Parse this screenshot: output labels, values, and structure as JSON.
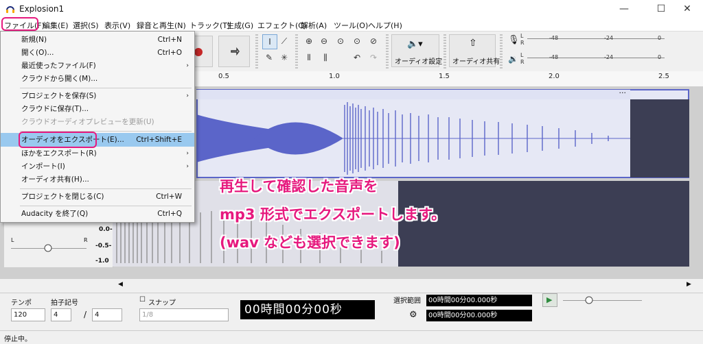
{
  "window": {
    "title": "Explosion1",
    "controls": {
      "minimize": "—",
      "maximize": "☐",
      "close": "✕"
    }
  },
  "menubar": {
    "items": [
      "ファイル(F)",
      "編集(E)",
      "選択(S)",
      "表示(V)",
      "録音と再生(N)",
      "トラック(T)",
      "生成(G)",
      "エフェクト(C)",
      "解析(A)",
      "ツール(O)",
      "ヘルプ(H)"
    ]
  },
  "toolbar": {
    "audio_setup_label": "オーディオ設定",
    "share_audio_label": "オーディオ共有",
    "meter_scale": [
      "-48",
      "-24",
      "0"
    ],
    "record_meter_lr": [
      "L",
      "R"
    ],
    "play_meter_lr": [
      "L",
      "R"
    ]
  },
  "ruler": {
    "ticks": [
      "0.5",
      "1.0",
      "1.5",
      "2.0",
      "2.5"
    ]
  },
  "track2": {
    "scale": [
      "0.0-",
      "-0.5-",
      "-1.0"
    ],
    "pan_labels": [
      "L",
      "R"
    ]
  },
  "file_menu": {
    "items": [
      {
        "label": "新規(N)",
        "shortcut": "Ctrl+N"
      },
      {
        "label": "開く(O)...",
        "shortcut": "Ctrl+O"
      },
      {
        "label": "最近使ったファイル(F)",
        "arrow": "›"
      },
      {
        "label": "クラウドから開く(M)..."
      },
      {
        "label": "プロジェクトを保存(S)",
        "arrow": "›"
      },
      {
        "label": "クラウドに保存(T)..."
      },
      {
        "label": "クラウドオーディオプレビューを更新(U)",
        "disabled": true
      },
      {
        "label": "オーディオをエクスポート(E)...",
        "shortcut": "Ctrl+Shift+E",
        "highlighted": true
      },
      {
        "label": "ほかをエクスポート(R)",
        "arrow": "›"
      },
      {
        "label": "インポート(I)",
        "arrow": "›"
      },
      {
        "label": "オーディオ共有(H)..."
      },
      {
        "label": "プロジェクトを閉じる(C)",
        "shortcut": "Ctrl+W"
      },
      {
        "label": "Audacity を終了(Q)",
        "shortcut": "Ctrl+Q"
      }
    ]
  },
  "annotation": {
    "line1": "再生して確認した音声を",
    "line2": "mp3 形式でエクスポートします。",
    "line3": "(wav なども選択できます)"
  },
  "bottom": {
    "tempo_label": "テンポ",
    "tempo_value": "120",
    "time_sig_label": "拍子記号",
    "time_sig_num": "4",
    "time_sig_sep": "/",
    "time_sig_den": "4",
    "snap_label": "スナップ",
    "snap_value": "1/8",
    "time_display": "00時間00分00秒",
    "selection_label": "選択範囲",
    "selection_start": "00時間00分00.000秒",
    "selection_end": "00時間00分00.000秒"
  },
  "status": {
    "text": "停止中。"
  },
  "colors": {
    "accent_pink": "#e6197e",
    "waveform_blue": "#5b65c9",
    "menu_highlight": "#99c9ef"
  }
}
